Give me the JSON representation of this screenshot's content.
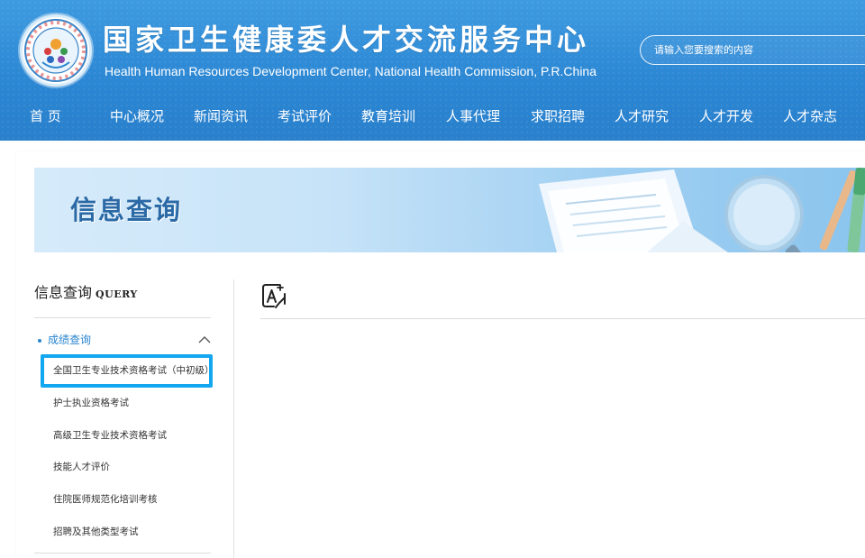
{
  "header": {
    "title_cn": "国家卫生健康委人才交流服务中心",
    "title_en": "Health Human Resources Development Center, National Health Commission, P.R.China",
    "logo_icon": "center-emblem-logo",
    "search_placeholder": "请输入您要搜索的内容",
    "background_color": "#2b86d3"
  },
  "nav": {
    "items": [
      {
        "label": "首    页"
      },
      {
        "label": "中心概况"
      },
      {
        "label": "新闻资讯"
      },
      {
        "label": "考试评价"
      },
      {
        "label": "教育培训"
      },
      {
        "label": "人事代理"
      },
      {
        "label": "求职招聘"
      },
      {
        "label": "人才研究"
      },
      {
        "label": "人才开发"
      },
      {
        "label": "人才杂志"
      }
    ]
  },
  "banner": {
    "title": "信息查询",
    "art_icon": "magnifier-documents-pens-illustration"
  },
  "sidebar": {
    "title": "信息查询",
    "title_en": "QUERY",
    "category": {
      "label": "成绩查询",
      "expanded": true,
      "icon": "chevron-up-icon"
    },
    "items": [
      {
        "label": "全国卫生专业技术资格考试（中初级）",
        "highlighted": true
      },
      {
        "label": "护士执业资格考试"
      },
      {
        "label": "高级卫生专业技术资格考试"
      },
      {
        "label": "技能人才评价"
      },
      {
        "label": "住院医师规范化培训考核"
      },
      {
        "label": "招聘及其他类型考试"
      }
    ],
    "accent_color": "#2a86d0",
    "highlight_color": "#13a7ef"
  },
  "main": {
    "font_size_icon": "font-size-adjust-icon"
  }
}
